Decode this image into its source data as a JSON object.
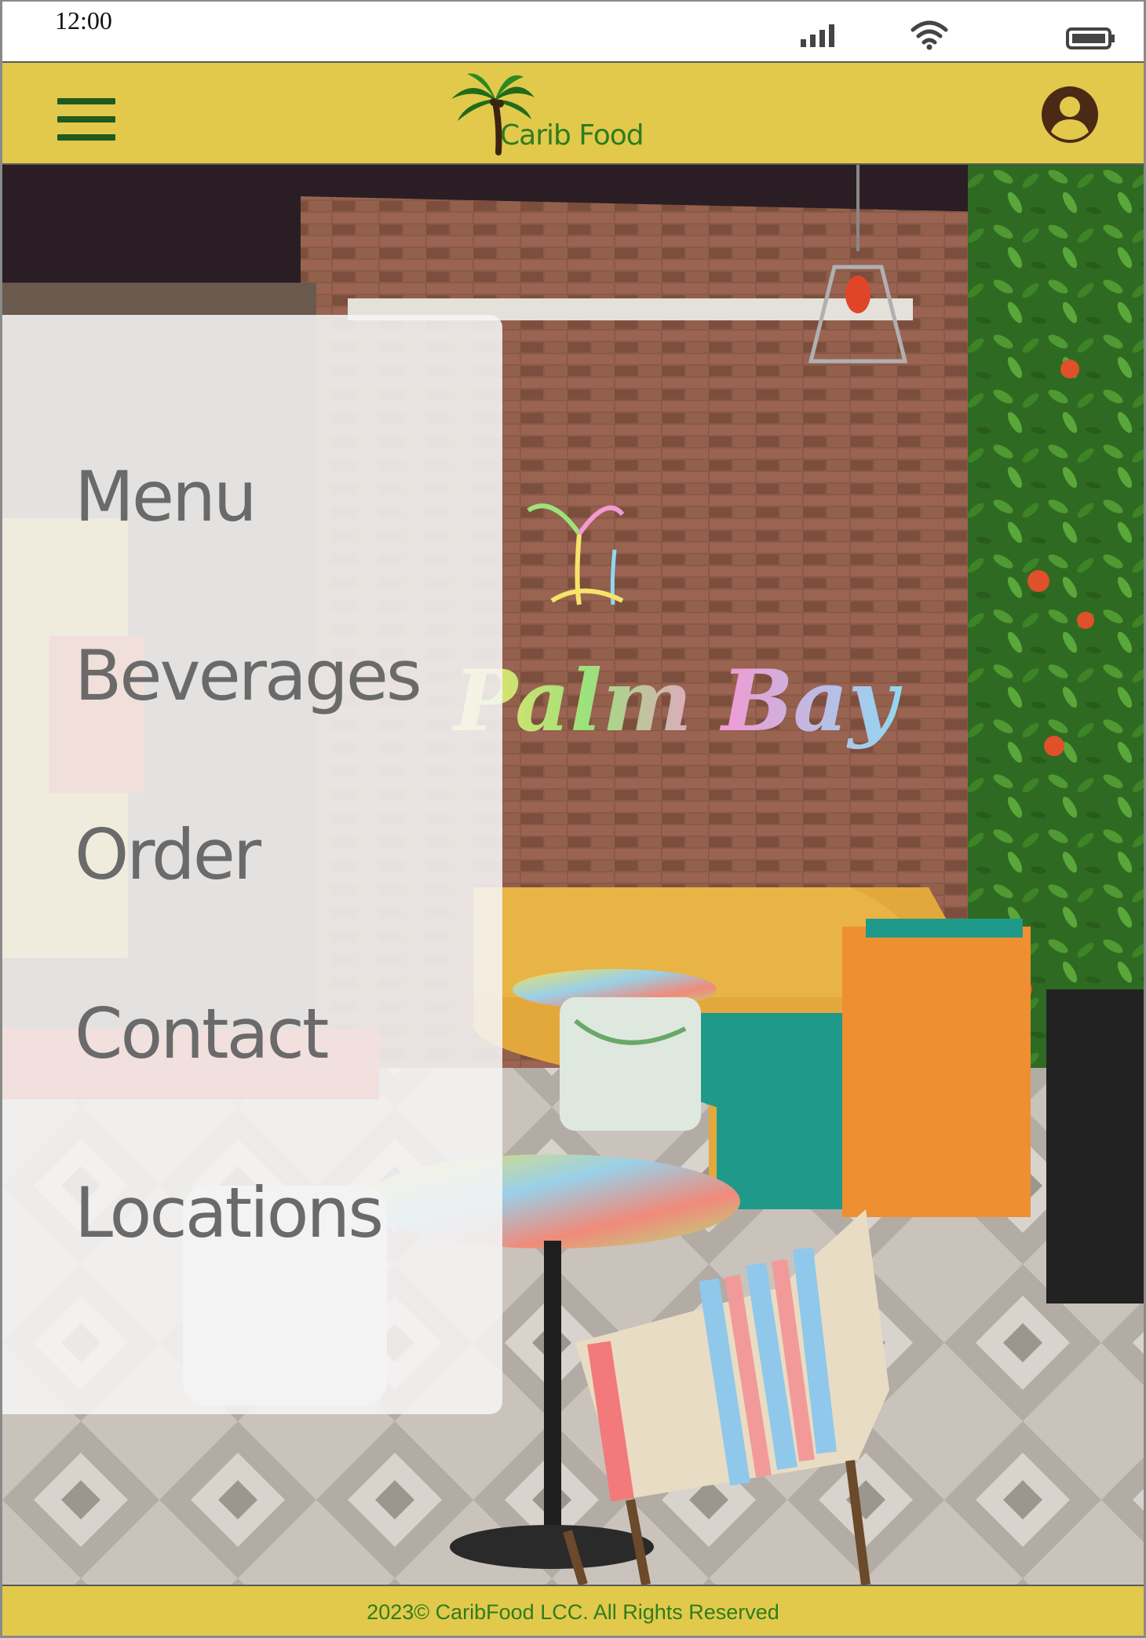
{
  "status_bar": {
    "time": "12:00",
    "icons": [
      "signal-icon",
      "wifi-icon",
      "battery-icon"
    ]
  },
  "header": {
    "logo_text": "Carib Food",
    "logo_icon": "palm-tree-icon",
    "menu_icon": "hamburger-icon",
    "account_icon": "account-circle-icon"
  },
  "hero": {
    "sign_text": "Palm Bay"
  },
  "side_menu": {
    "items": [
      {
        "label": "Menu"
      },
      {
        "label": "Beverages"
      },
      {
        "label": "Order"
      },
      {
        "label": "Contact"
      },
      {
        "label": "Locations"
      }
    ]
  },
  "footer": {
    "text": "2023©  CaribFood LCC. All Rights Reserved"
  },
  "colors": {
    "header_bg": "#e2c94c",
    "brand_green": "#2e7d1e",
    "menu_text": "#6a6a6a",
    "icon_brown": "#4a2a14"
  }
}
